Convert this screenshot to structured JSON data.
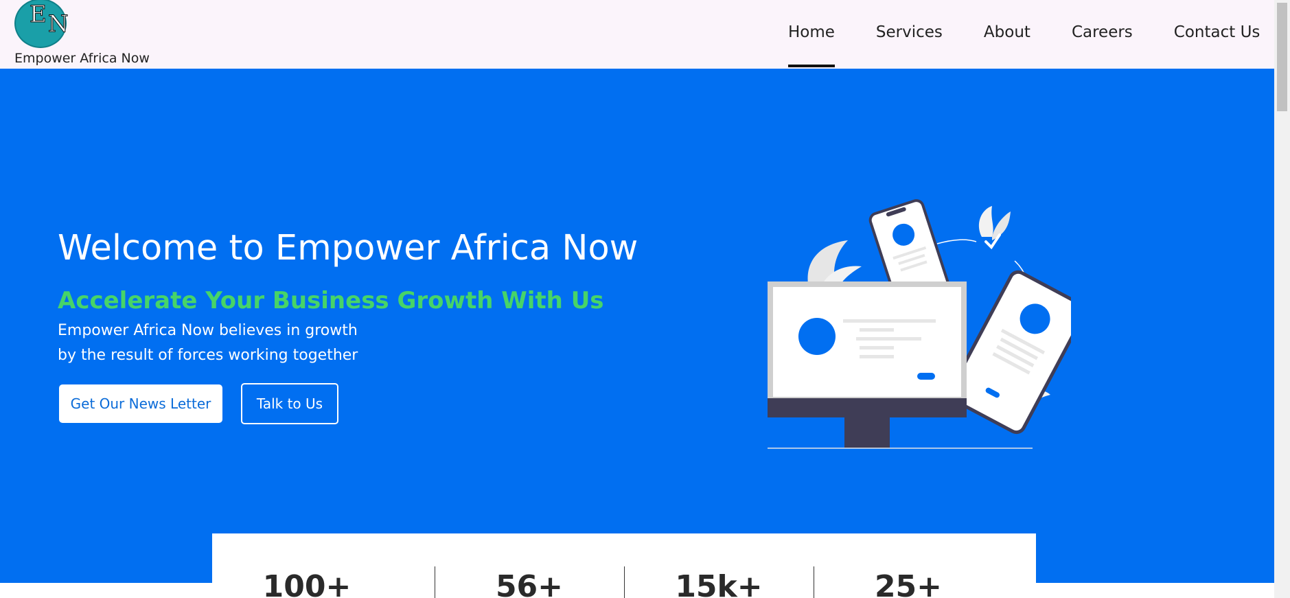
{
  "brand": {
    "logo_letters": "EN",
    "name": "Empower Africa Now"
  },
  "nav": {
    "items": [
      {
        "label": "Home",
        "active": true
      },
      {
        "label": "Services",
        "active": false
      },
      {
        "label": "About",
        "active": false
      },
      {
        "label": "Careers",
        "active": false
      },
      {
        "label": "Contact Us",
        "active": false
      }
    ]
  },
  "hero": {
    "title": "Welcome to Empower Africa Now",
    "subtitle": "Accelerate Your Business Growth With Us",
    "body_line1": "Empower Africa Now believes in growth",
    "body_line2": "by the result of forces working together",
    "newsletter_button": "Get Our News Letter",
    "talk_button": "Talk to Us"
  },
  "stats": [
    "100+",
    "56+",
    "15k+",
    "25+"
  ],
  "colors": {
    "hero_bg": "#016ff1",
    "subtitle": "#47d468",
    "nav_bg": "#fbf4fb",
    "logo": "#1a9fa8"
  }
}
